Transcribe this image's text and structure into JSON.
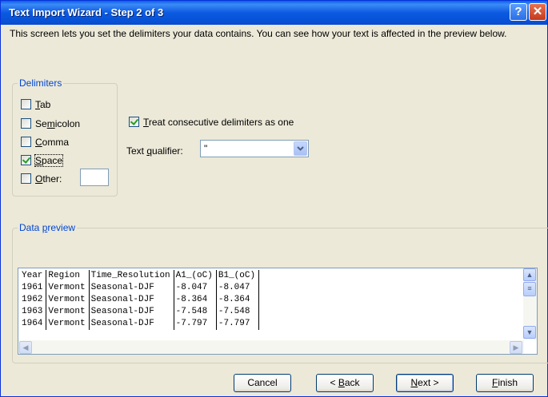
{
  "window": {
    "title": "Text Import Wizard - Step 2 of 3",
    "help_glyph": "?",
    "close_glyph": "✕"
  },
  "description": "This screen lets you set the delimiters your data contains.  You can see how your text is affected in the preview below.",
  "delimiters": {
    "legend": "Delimiters",
    "tab": {
      "label": "Tab",
      "checked": false
    },
    "semicolon": {
      "label": "Semicolon",
      "checked": false
    },
    "comma": {
      "label": "Comma",
      "checked": false
    },
    "space": {
      "label": "Space",
      "checked": true
    },
    "other": {
      "label": "Other:",
      "checked": false,
      "value": ""
    }
  },
  "consecutive": {
    "label": "Treat consecutive delimiters as one",
    "checked": true
  },
  "text_qualifier": {
    "label": "Text qualifier:",
    "value": "\""
  },
  "preview": {
    "legend": "Data preview",
    "rows": [
      [
        "Year",
        "Region",
        "Time_Resolution",
        "A1_(oC)",
        "B1_(oC)"
      ],
      [
        "1961",
        "Vermont",
        "Seasonal-DJF",
        "-8.047",
        "-8.047"
      ],
      [
        "1962",
        "Vermont",
        "Seasonal-DJF",
        "-8.364",
        "-8.364"
      ],
      [
        "1963",
        "Vermont",
        "Seasonal-DJF",
        "-7.548",
        "-7.548"
      ],
      [
        "1964",
        "Vermont",
        "Seasonal-DJF",
        "-7.797",
        "-7.797"
      ]
    ]
  },
  "buttons": {
    "cancel": "Cancel",
    "back": "< Back",
    "next": "Next >",
    "finish": "Finish"
  }
}
